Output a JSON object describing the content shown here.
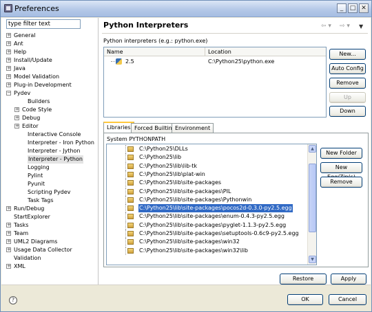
{
  "window": {
    "title": "Preferences",
    "minimize": "_",
    "maximize": "□",
    "close": "✕"
  },
  "filter": {
    "placeholder": "type filter text",
    "value": "type filter text"
  },
  "tree": [
    {
      "label": "General",
      "toggle": "+"
    },
    {
      "label": "Ant",
      "toggle": "+"
    },
    {
      "label": "Help",
      "toggle": "+"
    },
    {
      "label": "Install/Update",
      "toggle": "+"
    },
    {
      "label": "Java",
      "toggle": "+"
    },
    {
      "label": "Model Validation",
      "toggle": "+"
    },
    {
      "label": "Plug-in Development",
      "toggle": "+"
    },
    {
      "label": "Pydev",
      "toggle": "−"
    },
    {
      "label": "Builders",
      "toggle": ""
    },
    {
      "label": "Code Style",
      "toggle": "+"
    },
    {
      "label": "Debug",
      "toggle": "+"
    },
    {
      "label": "Editor",
      "toggle": "+"
    },
    {
      "label": "Interactive Console",
      "toggle": ""
    },
    {
      "label": "Interpreter - Iron Python",
      "toggle": ""
    },
    {
      "label": "Interpreter - Jython",
      "toggle": ""
    },
    {
      "label": "Interpreter - Python",
      "toggle": "",
      "selected": true
    },
    {
      "label": "Logging",
      "toggle": ""
    },
    {
      "label": "Pylint",
      "toggle": ""
    },
    {
      "label": "Pyunit",
      "toggle": ""
    },
    {
      "label": "Scripting Pydev",
      "toggle": ""
    },
    {
      "label": "Task Tags",
      "toggle": ""
    },
    {
      "label": "Run/Debug",
      "toggle": "+"
    },
    {
      "label": "StartExplorer",
      "toggle": ""
    },
    {
      "label": "Tasks",
      "toggle": "+"
    },
    {
      "label": "Team",
      "toggle": "+"
    },
    {
      "label": "UML2 Diagrams",
      "toggle": "+"
    },
    {
      "label": "Usage Data Collector",
      "toggle": "+"
    },
    {
      "label": "Validation",
      "toggle": ""
    },
    {
      "label": "XML",
      "toggle": "+"
    }
  ],
  "panel": {
    "title": "Python Interpreters",
    "nav_back": "⇦ ▾",
    "nav_forward": "⇨ ▾",
    "menu": "▼",
    "interpreters_label": "Python interpreters (e.g.: python.exe)",
    "columns": [
      "Name",
      "Location"
    ],
    "rows": [
      {
        "name": "2.5",
        "location": "C:\\Python25\\python.exe"
      }
    ],
    "buttons": {
      "new": "New...",
      "auto_config": "Auto Config",
      "remove": "Remove",
      "up": "Up",
      "down": "Down"
    }
  },
  "tabs": [
    "Libraries",
    "Forced Builtins",
    "Environment"
  ],
  "libraries": {
    "section_label": "System PYTHONPATH",
    "paths": [
      "C:\\Python25\\DLLs",
      "C:\\Python25\\lib",
      "C:\\Python25\\lib\\lib-tk",
      "C:\\Python25\\lib\\plat-win",
      "C:\\Python25\\lib\\site-packages",
      "C:\\Python25\\lib\\site-packages\\PIL",
      "C:\\Python25\\lib\\site-packages\\Pythonwin",
      "C:\\Python25\\lib\\site-packages\\pocos2d-0.3.0-py2.5.egg",
      "C:\\Python25\\lib\\site-packages\\enum-0.4.3-py2.5.egg",
      "C:\\Python25\\lib\\site-packages\\pyglet-1.1.3-py2.5.egg",
      "C:\\Python25\\lib\\site-packages\\setuptools-0.6c9-py2.5.egg",
      "C:\\Python25\\lib\\site-packages\\win32",
      "C:\\Python25\\lib\\site-packages\\win32\\lib"
    ],
    "selected_index": 7,
    "buttons": {
      "new_folder": "New Folder",
      "new_egg": "New Egg/Zip(s)",
      "remove": "Remove"
    }
  },
  "footer": {
    "restore_defaults": "Restore Defaults",
    "apply": "Apply",
    "ok": "OK",
    "cancel": "Cancel",
    "help": "?"
  }
}
